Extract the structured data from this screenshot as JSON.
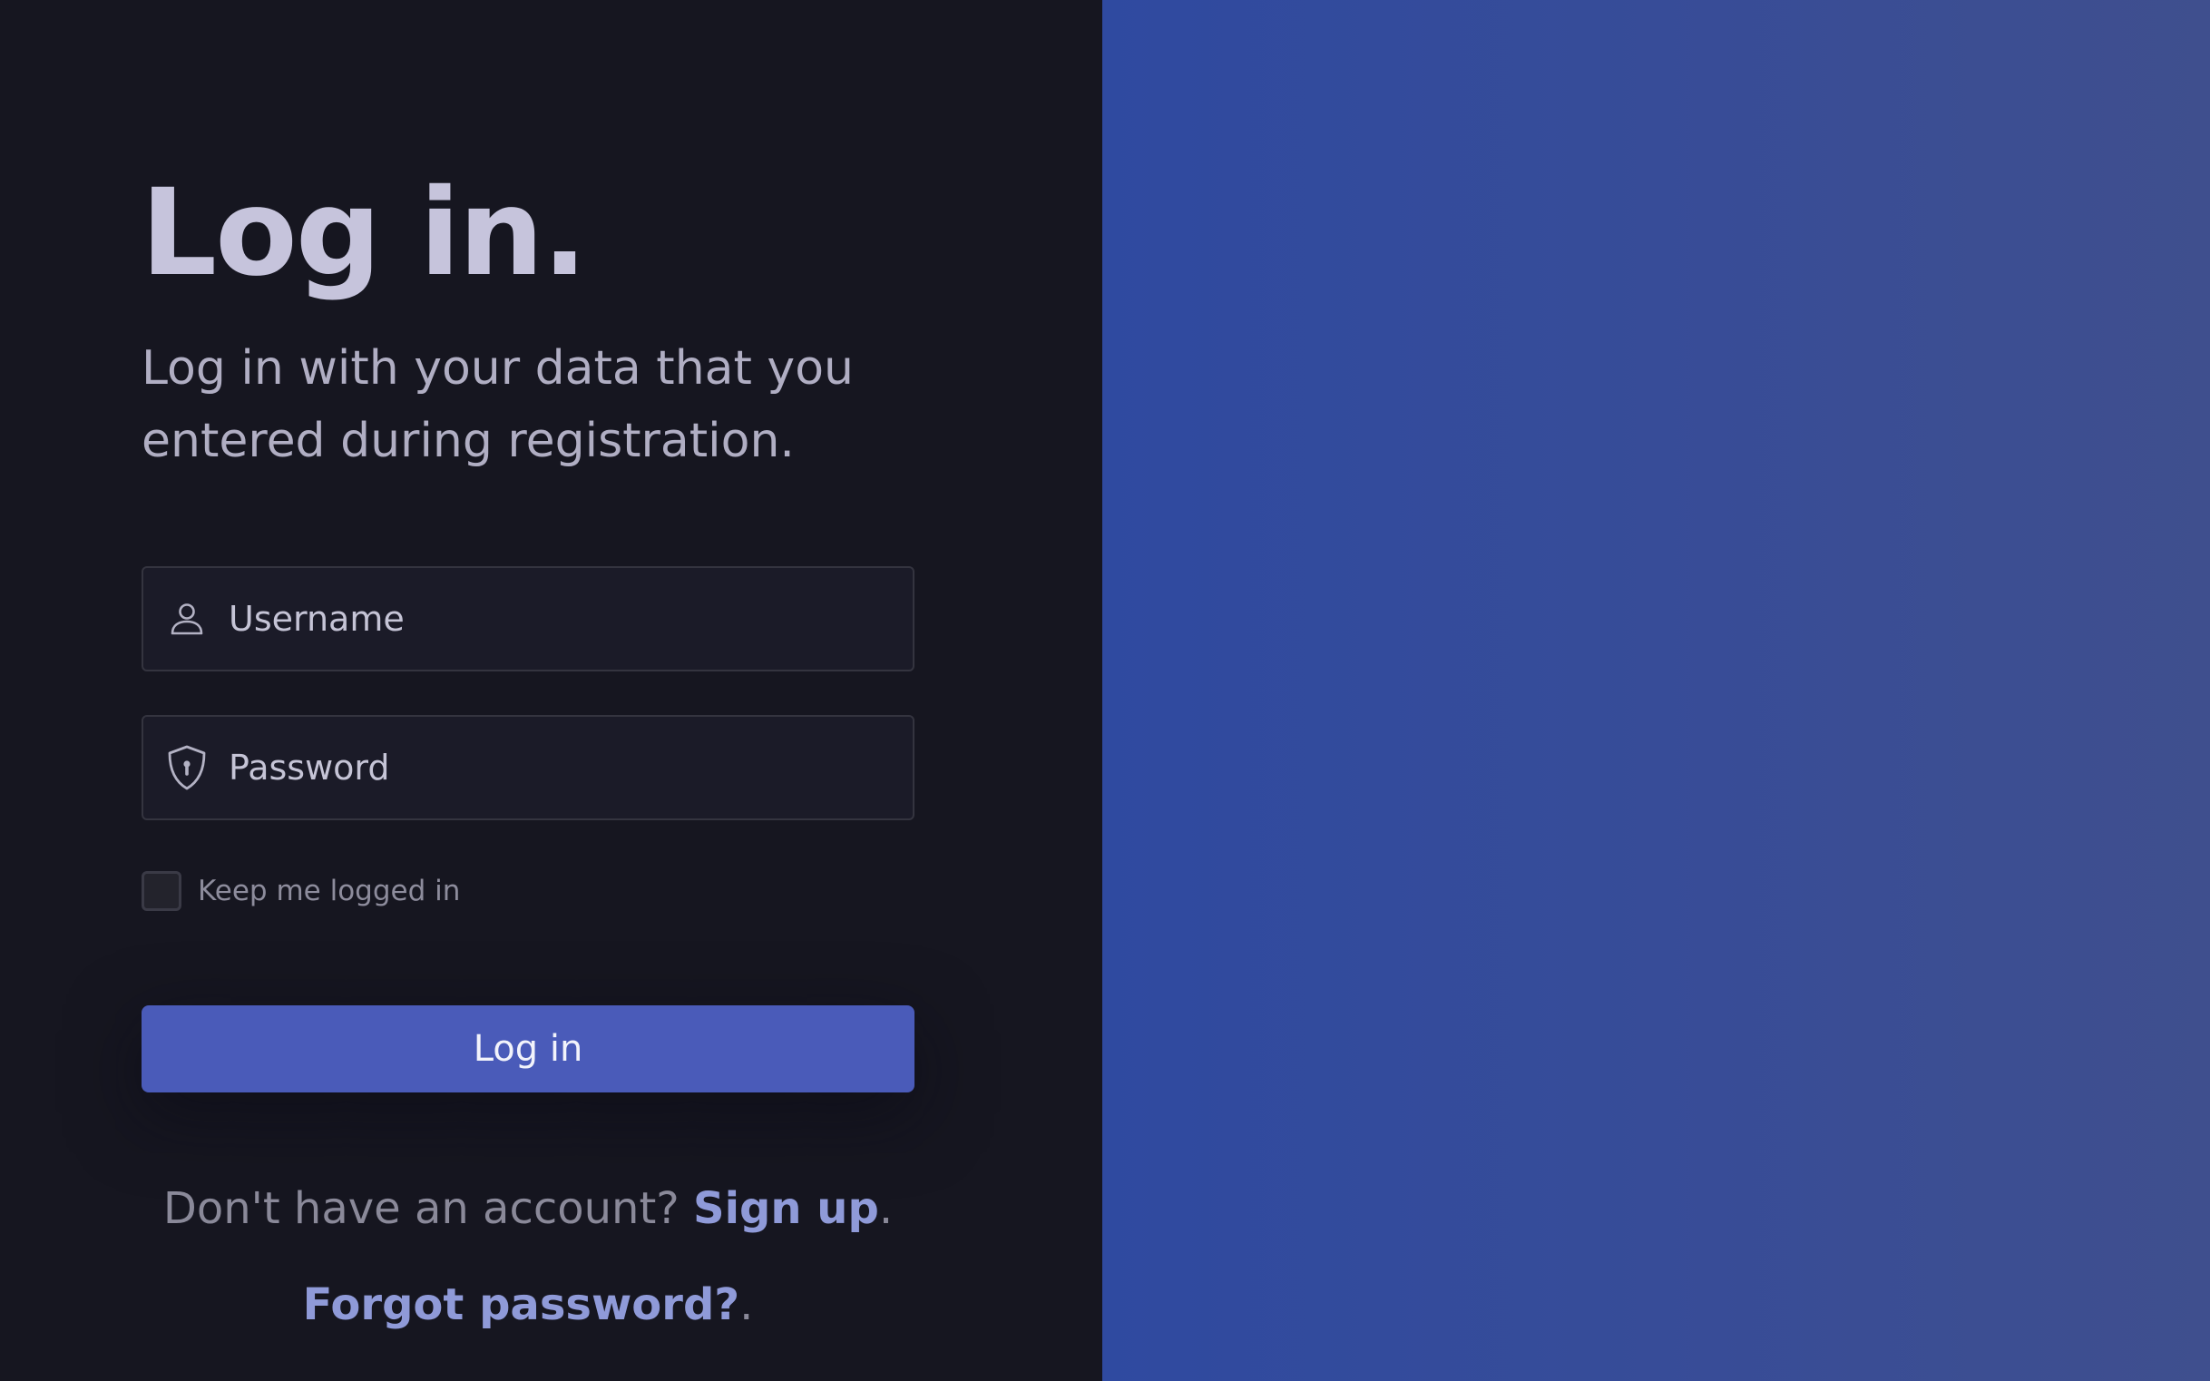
{
  "login": {
    "heading": "Log in.",
    "subtitle": "Log in with your data that you entered during registration.",
    "username": {
      "placeholder": "Username",
      "value": "",
      "icon": "user-icon"
    },
    "password": {
      "placeholder": "Password",
      "value": "",
      "icon": "shield-lock-icon"
    },
    "remember_label": "Keep me logged in",
    "remember_checked": false,
    "submit_label": "Log in",
    "signup_prompt": "Don't have an account? ",
    "signup_link": "Sign up",
    "signup_suffix": ".",
    "forgot_link": "Forgot password?",
    "forgot_suffix": "."
  },
  "colors": {
    "left_background": "#161620",
    "right_gradient_start": "#2f4aa0",
    "right_gradient_end": "#3f4f8e",
    "accent": "#4a5bb9",
    "link": "#8f9ad8",
    "heading": "#c6c4dc"
  }
}
